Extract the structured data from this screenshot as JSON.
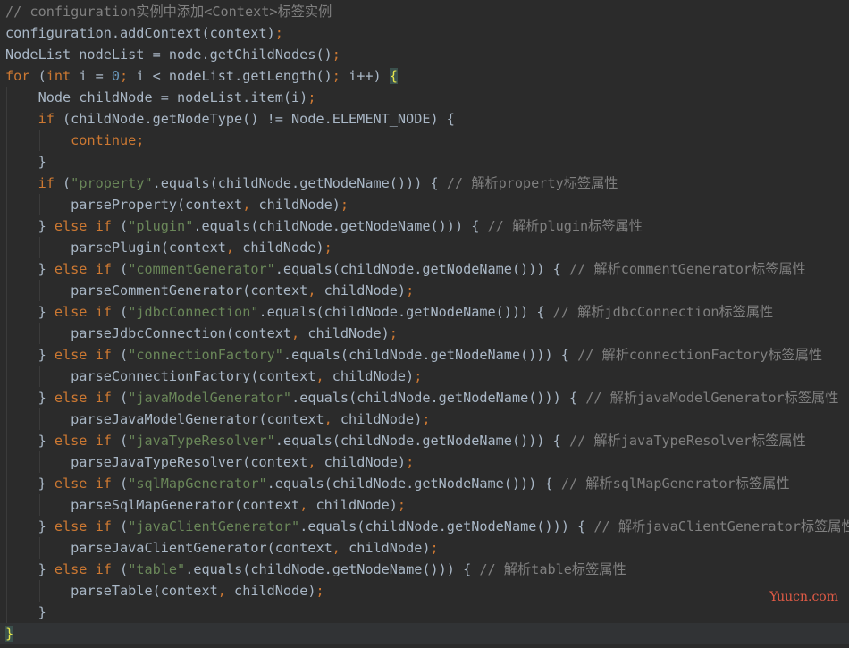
{
  "colors": {
    "background": "#2b2b2b",
    "plain": "#a9b7c6",
    "keyword": "#cc7832",
    "string": "#6a8759",
    "number": "#6897bb",
    "comment": "#808080",
    "brace_highlight": "#e6e64d",
    "watermark": "#e25b46"
  },
  "watermark": "Yuucn.com",
  "lines": [
    {
      "indent": 0,
      "tokens": [
        {
          "t": "// configuration实例中添加<Context>标签实例",
          "c": "comment"
        }
      ]
    },
    {
      "indent": 0,
      "tokens": [
        {
          "t": "configuration.addContext(context)",
          "c": "plain"
        },
        {
          "t": ";",
          "c": "keyword"
        }
      ]
    },
    {
      "indent": 0,
      "tokens": [
        {
          "t": "NodeList nodeList = node.getChildNodes()",
          "c": "plain"
        },
        {
          "t": ";",
          "c": "keyword"
        }
      ]
    },
    {
      "indent": 0,
      "tokens": [
        {
          "t": "for ",
          "c": "keyword"
        },
        {
          "t": "(",
          "c": "plain"
        },
        {
          "t": "int ",
          "c": "keyword"
        },
        {
          "t": "i = ",
          "c": "plain"
        },
        {
          "t": "0",
          "c": "number"
        },
        {
          "t": "; ",
          "c": "keyword"
        },
        {
          "t": "i < nodeList.getLength()",
          "c": "plain"
        },
        {
          "t": "; ",
          "c": "keyword"
        },
        {
          "t": "i++) ",
          "c": "plain"
        },
        {
          "t": "{",
          "c": "brace"
        }
      ]
    },
    {
      "indent": 1,
      "tokens": [
        {
          "t": "Node childNode = nodeList.item(i)",
          "c": "plain"
        },
        {
          "t": ";",
          "c": "keyword"
        }
      ]
    },
    {
      "indent": 1,
      "tokens": [
        {
          "t": "if ",
          "c": "keyword"
        },
        {
          "t": "(childNode.getNodeType() != Node.ELEMENT_NODE) {",
          "c": "plain"
        }
      ]
    },
    {
      "indent": 2,
      "tokens": [
        {
          "t": "continue;",
          "c": "keyword"
        }
      ]
    },
    {
      "indent": 1,
      "tokens": [
        {
          "t": "}",
          "c": "plain"
        }
      ]
    },
    {
      "indent": 1,
      "tokens": [
        {
          "t": "if ",
          "c": "keyword"
        },
        {
          "t": "(",
          "c": "plain"
        },
        {
          "t": "\"property\"",
          "c": "string"
        },
        {
          "t": ".equals(childNode.getNodeName())) { ",
          "c": "plain"
        },
        {
          "t": "// 解析property标签属性",
          "c": "comment"
        }
      ]
    },
    {
      "indent": 2,
      "tokens": [
        {
          "t": "parseProperty(context",
          "c": "plain"
        },
        {
          "t": ", ",
          "c": "keyword"
        },
        {
          "t": "childNode)",
          "c": "plain"
        },
        {
          "t": ";",
          "c": "keyword"
        }
      ]
    },
    {
      "indent": 1,
      "tokens": [
        {
          "t": "} ",
          "c": "plain"
        },
        {
          "t": "else if ",
          "c": "keyword"
        },
        {
          "t": "(",
          "c": "plain"
        },
        {
          "t": "\"plugin\"",
          "c": "string"
        },
        {
          "t": ".equals(childNode.getNodeName())) { ",
          "c": "plain"
        },
        {
          "t": "// 解析plugin标签属性",
          "c": "comment"
        }
      ]
    },
    {
      "indent": 2,
      "tokens": [
        {
          "t": "parsePlugin(context",
          "c": "plain"
        },
        {
          "t": ", ",
          "c": "keyword"
        },
        {
          "t": "childNode)",
          "c": "plain"
        },
        {
          "t": ";",
          "c": "keyword"
        }
      ]
    },
    {
      "indent": 1,
      "tokens": [
        {
          "t": "} ",
          "c": "plain"
        },
        {
          "t": "else if ",
          "c": "keyword"
        },
        {
          "t": "(",
          "c": "plain"
        },
        {
          "t": "\"commentGenerator\"",
          "c": "string"
        },
        {
          "t": ".equals(childNode.getNodeName())) { ",
          "c": "plain"
        },
        {
          "t": "// 解析commentGenerator标签属性",
          "c": "comment"
        }
      ]
    },
    {
      "indent": 2,
      "tokens": [
        {
          "t": "parseCommentGenerator(context",
          "c": "plain"
        },
        {
          "t": ", ",
          "c": "keyword"
        },
        {
          "t": "childNode)",
          "c": "plain"
        },
        {
          "t": ";",
          "c": "keyword"
        }
      ]
    },
    {
      "indent": 1,
      "tokens": [
        {
          "t": "} ",
          "c": "plain"
        },
        {
          "t": "else if ",
          "c": "keyword"
        },
        {
          "t": "(",
          "c": "plain"
        },
        {
          "t": "\"jdbcConnection\"",
          "c": "string"
        },
        {
          "t": ".equals(childNode.getNodeName())) { ",
          "c": "plain"
        },
        {
          "t": "// 解析jdbcConnection标签属性",
          "c": "comment"
        }
      ]
    },
    {
      "indent": 2,
      "tokens": [
        {
          "t": "parseJdbcConnection(context",
          "c": "plain"
        },
        {
          "t": ", ",
          "c": "keyword"
        },
        {
          "t": "childNode)",
          "c": "plain"
        },
        {
          "t": ";",
          "c": "keyword"
        }
      ]
    },
    {
      "indent": 1,
      "tokens": [
        {
          "t": "} ",
          "c": "plain"
        },
        {
          "t": "else if ",
          "c": "keyword"
        },
        {
          "t": "(",
          "c": "plain"
        },
        {
          "t": "\"connectionFactory\"",
          "c": "string"
        },
        {
          "t": ".equals(childNode.getNodeName())) { ",
          "c": "plain"
        },
        {
          "t": "// 解析connectionFactory标签属性",
          "c": "comment"
        }
      ]
    },
    {
      "indent": 2,
      "tokens": [
        {
          "t": "parseConnectionFactory(context",
          "c": "plain"
        },
        {
          "t": ", ",
          "c": "keyword"
        },
        {
          "t": "childNode)",
          "c": "plain"
        },
        {
          "t": ";",
          "c": "keyword"
        }
      ]
    },
    {
      "indent": 1,
      "tokens": [
        {
          "t": "} ",
          "c": "plain"
        },
        {
          "t": "else if ",
          "c": "keyword"
        },
        {
          "t": "(",
          "c": "plain"
        },
        {
          "t": "\"javaModelGenerator\"",
          "c": "string"
        },
        {
          "t": ".equals(childNode.getNodeName())) { ",
          "c": "plain"
        },
        {
          "t": "// 解析javaModelGenerator标签属性",
          "c": "comment"
        }
      ]
    },
    {
      "indent": 2,
      "tokens": [
        {
          "t": "parseJavaModelGenerator(context",
          "c": "plain"
        },
        {
          "t": ", ",
          "c": "keyword"
        },
        {
          "t": "childNode)",
          "c": "plain"
        },
        {
          "t": ";",
          "c": "keyword"
        }
      ]
    },
    {
      "indent": 1,
      "tokens": [
        {
          "t": "} ",
          "c": "plain"
        },
        {
          "t": "else if ",
          "c": "keyword"
        },
        {
          "t": "(",
          "c": "plain"
        },
        {
          "t": "\"javaTypeResolver\"",
          "c": "string"
        },
        {
          "t": ".equals(childNode.getNodeName())) { ",
          "c": "plain"
        },
        {
          "t": "// 解析javaTypeResolver标签属性",
          "c": "comment"
        }
      ]
    },
    {
      "indent": 2,
      "tokens": [
        {
          "t": "parseJavaTypeResolver(context",
          "c": "plain"
        },
        {
          "t": ", ",
          "c": "keyword"
        },
        {
          "t": "childNode)",
          "c": "plain"
        },
        {
          "t": ";",
          "c": "keyword"
        }
      ]
    },
    {
      "indent": 1,
      "tokens": [
        {
          "t": "} ",
          "c": "plain"
        },
        {
          "t": "else if ",
          "c": "keyword"
        },
        {
          "t": "(",
          "c": "plain"
        },
        {
          "t": "\"sqlMapGenerator\"",
          "c": "string"
        },
        {
          "t": ".equals(childNode.getNodeName())) { ",
          "c": "plain"
        },
        {
          "t": "// 解析sqlMapGenerator标签属性",
          "c": "comment"
        }
      ]
    },
    {
      "indent": 2,
      "tokens": [
        {
          "t": "parseSqlMapGenerator(context",
          "c": "plain"
        },
        {
          "t": ", ",
          "c": "keyword"
        },
        {
          "t": "childNode)",
          "c": "plain"
        },
        {
          "t": ";",
          "c": "keyword"
        }
      ]
    },
    {
      "indent": 1,
      "tokens": [
        {
          "t": "} ",
          "c": "plain"
        },
        {
          "t": "else if ",
          "c": "keyword"
        },
        {
          "t": "(",
          "c": "plain"
        },
        {
          "t": "\"javaClientGenerator\"",
          "c": "string"
        },
        {
          "t": ".equals(childNode.getNodeName())) { ",
          "c": "plain"
        },
        {
          "t": "// 解析javaClientGenerator标签属性",
          "c": "comment"
        }
      ]
    },
    {
      "indent": 2,
      "tokens": [
        {
          "t": "parseJavaClientGenerator(context",
          "c": "plain"
        },
        {
          "t": ", ",
          "c": "keyword"
        },
        {
          "t": "childNode)",
          "c": "plain"
        },
        {
          "t": ";",
          "c": "keyword"
        }
      ]
    },
    {
      "indent": 1,
      "tokens": [
        {
          "t": "} ",
          "c": "plain"
        },
        {
          "t": "else if ",
          "c": "keyword"
        },
        {
          "t": "(",
          "c": "plain"
        },
        {
          "t": "\"table\"",
          "c": "string"
        },
        {
          "t": ".equals(childNode.getNodeName())) { ",
          "c": "plain"
        },
        {
          "t": "// 解析table标签属性",
          "c": "comment"
        }
      ]
    },
    {
      "indent": 2,
      "tokens": [
        {
          "t": "parseTable(context",
          "c": "plain"
        },
        {
          "t": ", ",
          "c": "keyword"
        },
        {
          "t": "childNode)",
          "c": "plain"
        },
        {
          "t": ";",
          "c": "keyword"
        }
      ]
    },
    {
      "indent": 1,
      "tokens": [
        {
          "t": "}",
          "c": "plain"
        }
      ]
    },
    {
      "indent": 0,
      "tokens": [
        {
          "t": "}",
          "c": "brace"
        }
      ]
    }
  ]
}
